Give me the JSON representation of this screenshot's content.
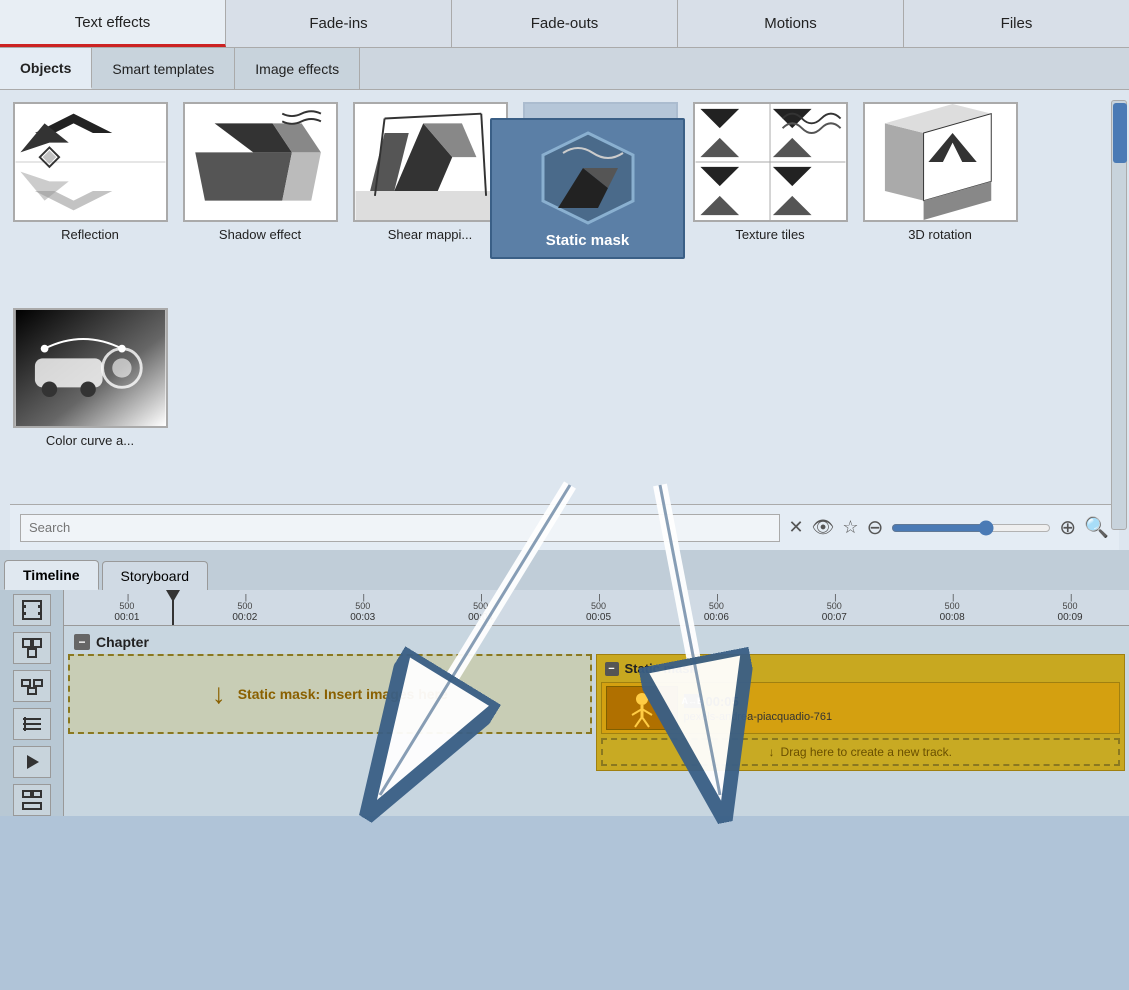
{
  "topTabs": {
    "tabs": [
      {
        "label": "Text effects",
        "active": true
      },
      {
        "label": "Fade-ins"
      },
      {
        "label": "Fade-outs"
      },
      {
        "label": "Motions"
      },
      {
        "label": "Files"
      }
    ]
  },
  "secondTabs": {
    "tabs": [
      {
        "label": "Objects",
        "active": true
      },
      {
        "label": "Smart templates"
      },
      {
        "label": "Image effects"
      }
    ]
  },
  "effectsGrid": {
    "items": [
      {
        "label": "Reflection"
      },
      {
        "label": "Shadow effect"
      },
      {
        "label": "Shear mappi..."
      },
      {
        "label": "Static mask",
        "highlighted": true
      },
      {
        "label": "Texture tiles"
      },
      {
        "label": "3D rotation"
      },
      {
        "label": "Color curve a..."
      }
    ]
  },
  "tooltip": {
    "label": "Static mask"
  },
  "searchBar": {
    "placeholder": "Search",
    "value": ""
  },
  "timeline": {
    "tabs": [
      {
        "label": "Timeline",
        "active": true
      },
      {
        "label": "Storyboard"
      }
    ],
    "rulerMarks": [
      "00:01",
      "00:02",
      "00:03",
      "00:04",
      "00:05",
      "00:06",
      "00:07",
      "00:08",
      "00:09"
    ],
    "chapterLabel": "Chapter",
    "insertTrackText": "Static mask: Insert images here",
    "staticMaskHeader": "Static mask",
    "mediaClip": {
      "duration": "00:05",
      "filename": "pexels-andrea-piacquadio-761"
    },
    "dragNewTrack": "Drag here to create a new track."
  }
}
